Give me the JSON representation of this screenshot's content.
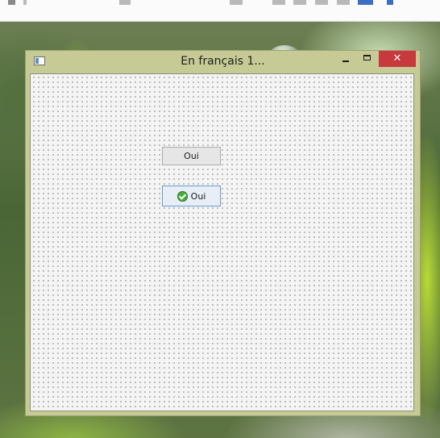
{
  "window": {
    "title": "En français 1...",
    "close_glyph": "✕"
  },
  "buttons": [
    {
      "label": "Oui"
    },
    {
      "label": "Oui",
      "icon": "check-icon"
    }
  ],
  "colors": {
    "titlebar": "#c6cb95",
    "close_button": "#c7393d",
    "focused_button_border": "#6a9bd3"
  }
}
